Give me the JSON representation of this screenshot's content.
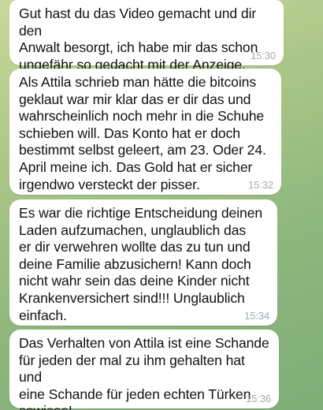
{
  "messages": [
    {
      "text": "Gut hast du das Video gemacht und dir den\nAnwalt besorgt, ich habe mir das schon\nungefähr so gedacht mit der Anzeige.",
      "time": "15:30"
    },
    {
      "text": "Als Attila schrieb man hätte die bitcoins\ngeklaut war mir klar das er dir das und\nwahrscheinlich noch mehr in die Schuhe\nschieben will. Das Konto hat er doch\nbestimmt selbst geleert, am 23. Oder 24.\nApril meine ich. Das Gold hat er sicher\nirgendwo versteckt der pisser.",
      "time": "15:32"
    },
    {
      "text": "Es war die richtige Entscheidung deinen\nLaden aufzumachen, unglaublich das\ner dir verwehren wollte das zu tun und\ndeine Familie abzusichern! Kann doch\nnicht wahr sein das deine Kinder nicht\nKrankenversichert sind!!! Unglaublich\neinfach.",
      "time": "15:34"
    },
    {
      "text": "Das Verhalten von Attila ist eine Schande\nfür jeden der mal zu ihm gehalten hat und\neine Schande für jeden echten Türken\nsowieso!",
      "time": "15:36"
    }
  ],
  "colors": {
    "bubble": "#ffffff",
    "timestamp": "#a3abb2",
    "background": "#9dbf80"
  }
}
